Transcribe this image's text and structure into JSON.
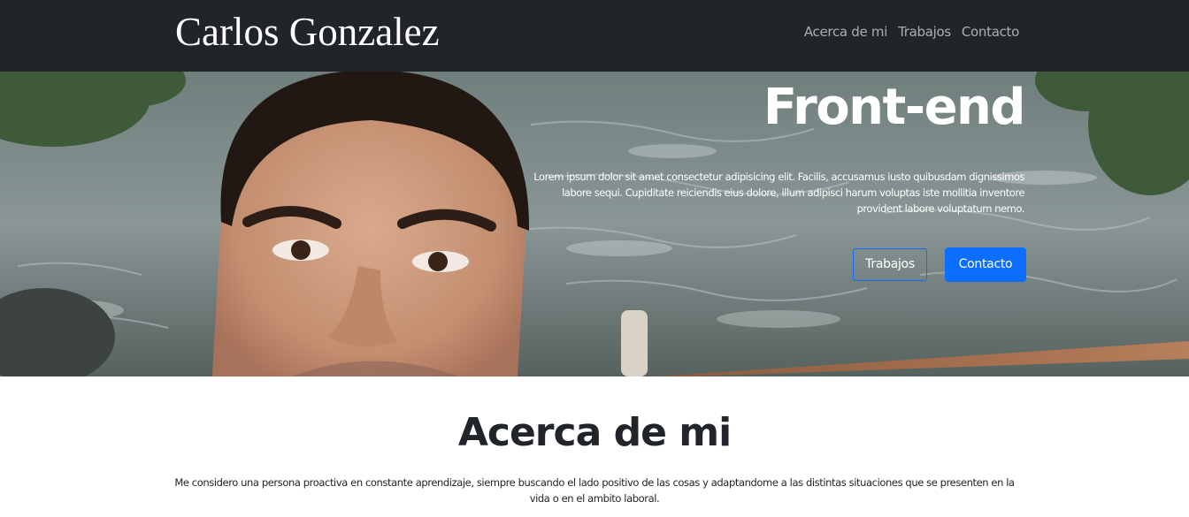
{
  "navbar": {
    "brand": "Carlos Gonzalez",
    "links": [
      "Acerca de mi",
      "Trabajos",
      "Contacto"
    ]
  },
  "hero": {
    "title": "Front-end",
    "description": "Lorem ipsum dolor sit amet consectetur adipisicing elit. Facilis, accusamus iusto quibusdam dignissimos labore sequi. Cupiditate reiciendis eius dolore, illum adipisci harum voluptas iste mollitia inventore provident labore voluptatum nemo.",
    "buttons": {
      "outline": "Trabajos",
      "primary": "Contacto"
    }
  },
  "about": {
    "title": "Acerca de mi",
    "text": "Me considero una persona proactiva en constante aprendizaje, siempre buscando el lado positivo de las cosas y adaptandome a las distintas situaciones que se presenten en la vida o en el ambito laboral."
  },
  "colors": {
    "navbar_bg": "#212529",
    "accent": "#0d6efd"
  }
}
